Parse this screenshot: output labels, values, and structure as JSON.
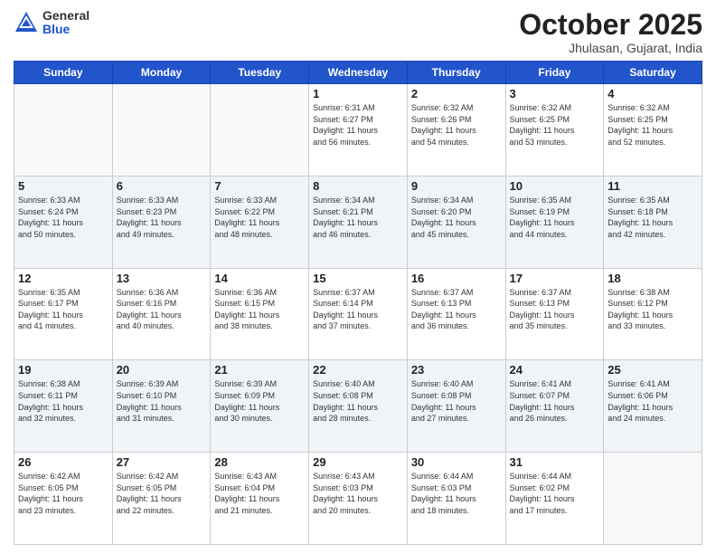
{
  "header": {
    "logo_general": "General",
    "logo_blue": "Blue",
    "month": "October 2025",
    "location": "Jhulasan, Gujarat, India"
  },
  "weekdays": [
    "Sunday",
    "Monday",
    "Tuesday",
    "Wednesday",
    "Thursday",
    "Friday",
    "Saturday"
  ],
  "weeks": [
    [
      {
        "day": "",
        "info": ""
      },
      {
        "day": "",
        "info": ""
      },
      {
        "day": "",
        "info": ""
      },
      {
        "day": "1",
        "info": "Sunrise: 6:31 AM\nSunset: 6:27 PM\nDaylight: 11 hours\nand 56 minutes."
      },
      {
        "day": "2",
        "info": "Sunrise: 6:32 AM\nSunset: 6:26 PM\nDaylight: 11 hours\nand 54 minutes."
      },
      {
        "day": "3",
        "info": "Sunrise: 6:32 AM\nSunset: 6:25 PM\nDaylight: 11 hours\nand 53 minutes."
      },
      {
        "day": "4",
        "info": "Sunrise: 6:32 AM\nSunset: 6:25 PM\nDaylight: 11 hours\nand 52 minutes."
      }
    ],
    [
      {
        "day": "5",
        "info": "Sunrise: 6:33 AM\nSunset: 6:24 PM\nDaylight: 11 hours\nand 50 minutes."
      },
      {
        "day": "6",
        "info": "Sunrise: 6:33 AM\nSunset: 6:23 PM\nDaylight: 11 hours\nand 49 minutes."
      },
      {
        "day": "7",
        "info": "Sunrise: 6:33 AM\nSunset: 6:22 PM\nDaylight: 11 hours\nand 48 minutes."
      },
      {
        "day": "8",
        "info": "Sunrise: 6:34 AM\nSunset: 6:21 PM\nDaylight: 11 hours\nand 46 minutes."
      },
      {
        "day": "9",
        "info": "Sunrise: 6:34 AM\nSunset: 6:20 PM\nDaylight: 11 hours\nand 45 minutes."
      },
      {
        "day": "10",
        "info": "Sunrise: 6:35 AM\nSunset: 6:19 PM\nDaylight: 11 hours\nand 44 minutes."
      },
      {
        "day": "11",
        "info": "Sunrise: 6:35 AM\nSunset: 6:18 PM\nDaylight: 11 hours\nand 42 minutes."
      }
    ],
    [
      {
        "day": "12",
        "info": "Sunrise: 6:35 AM\nSunset: 6:17 PM\nDaylight: 11 hours\nand 41 minutes."
      },
      {
        "day": "13",
        "info": "Sunrise: 6:36 AM\nSunset: 6:16 PM\nDaylight: 11 hours\nand 40 minutes."
      },
      {
        "day": "14",
        "info": "Sunrise: 6:36 AM\nSunset: 6:15 PM\nDaylight: 11 hours\nand 38 minutes."
      },
      {
        "day": "15",
        "info": "Sunrise: 6:37 AM\nSunset: 6:14 PM\nDaylight: 11 hours\nand 37 minutes."
      },
      {
        "day": "16",
        "info": "Sunrise: 6:37 AM\nSunset: 6:13 PM\nDaylight: 11 hours\nand 36 minutes."
      },
      {
        "day": "17",
        "info": "Sunrise: 6:37 AM\nSunset: 6:13 PM\nDaylight: 11 hours\nand 35 minutes."
      },
      {
        "day": "18",
        "info": "Sunrise: 6:38 AM\nSunset: 6:12 PM\nDaylight: 11 hours\nand 33 minutes."
      }
    ],
    [
      {
        "day": "19",
        "info": "Sunrise: 6:38 AM\nSunset: 6:11 PM\nDaylight: 11 hours\nand 32 minutes."
      },
      {
        "day": "20",
        "info": "Sunrise: 6:39 AM\nSunset: 6:10 PM\nDaylight: 11 hours\nand 31 minutes."
      },
      {
        "day": "21",
        "info": "Sunrise: 6:39 AM\nSunset: 6:09 PM\nDaylight: 11 hours\nand 30 minutes."
      },
      {
        "day": "22",
        "info": "Sunrise: 6:40 AM\nSunset: 6:08 PM\nDaylight: 11 hours\nand 28 minutes."
      },
      {
        "day": "23",
        "info": "Sunrise: 6:40 AM\nSunset: 6:08 PM\nDaylight: 11 hours\nand 27 minutes."
      },
      {
        "day": "24",
        "info": "Sunrise: 6:41 AM\nSunset: 6:07 PM\nDaylight: 11 hours\nand 26 minutes."
      },
      {
        "day": "25",
        "info": "Sunrise: 6:41 AM\nSunset: 6:06 PM\nDaylight: 11 hours\nand 24 minutes."
      }
    ],
    [
      {
        "day": "26",
        "info": "Sunrise: 6:42 AM\nSunset: 6:05 PM\nDaylight: 11 hours\nand 23 minutes."
      },
      {
        "day": "27",
        "info": "Sunrise: 6:42 AM\nSunset: 6:05 PM\nDaylight: 11 hours\nand 22 minutes."
      },
      {
        "day": "28",
        "info": "Sunrise: 6:43 AM\nSunset: 6:04 PM\nDaylight: 11 hours\nand 21 minutes."
      },
      {
        "day": "29",
        "info": "Sunrise: 6:43 AM\nSunset: 6:03 PM\nDaylight: 11 hours\nand 20 minutes."
      },
      {
        "day": "30",
        "info": "Sunrise: 6:44 AM\nSunset: 6:03 PM\nDaylight: 11 hours\nand 18 minutes."
      },
      {
        "day": "31",
        "info": "Sunrise: 6:44 AM\nSunset: 6:02 PM\nDaylight: 11 hours\nand 17 minutes."
      },
      {
        "day": "",
        "info": ""
      }
    ]
  ]
}
